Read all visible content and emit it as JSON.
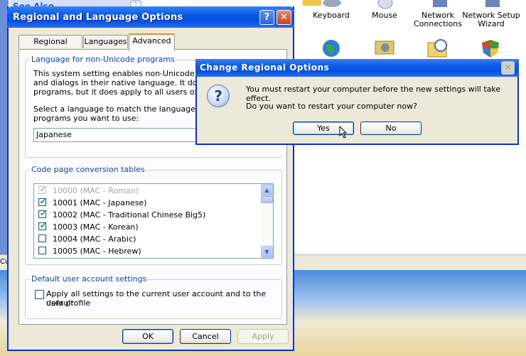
{
  "background": {
    "see_also": "See Also",
    "strip_cut": "Cus",
    "control_panel_items": [
      {
        "label": "Keyboard",
        "icon": "keyboard-icon"
      },
      {
        "label": "Mouse",
        "icon": "mouse-icon"
      },
      {
        "label": "Network Connections",
        "icon": "network-connections-icon"
      },
      {
        "label": "Network Setup Wizard",
        "icon": "network-wizard-icon"
      }
    ]
  },
  "dialog": {
    "title": "Regional and Language Options",
    "help": "?",
    "close": "✕",
    "tabs": [
      "Regional Options",
      "Languages",
      "Advanced"
    ],
    "active_tab": "Advanced",
    "non_unicode": {
      "legend": "Language for non-Unicode programs",
      "desc_lines": [
        "This system setting enables non-Unicode program",
        "and dialogs in their native language. It does not a",
        "programs, but it does apply to all users of this cor"
      ],
      "select_lines": [
        "Select a language to match the language version",
        "programs you want to use:"
      ],
      "selected_language": "Japanese"
    },
    "code_pages": {
      "legend": "Code page conversion tables",
      "items": [
        {
          "label": "10000 (MAC - Roman)",
          "checked": true,
          "disabled": true
        },
        {
          "label": "10001 (MAC - Japanese)",
          "checked": true,
          "disabled": false
        },
        {
          "label": "10002 (MAC - Traditional Chinese Big5)",
          "checked": true,
          "disabled": false
        },
        {
          "label": "10003 (MAC - Korean)",
          "checked": true,
          "disabled": false
        },
        {
          "label": "10004 (MAC - Arabic)",
          "checked": false,
          "disabled": false
        },
        {
          "label": "10005 (MAC - Hebrew)",
          "checked": false,
          "disabled": false
        }
      ]
    },
    "default_user": {
      "legend": "Default user account settings",
      "checkbox_line1": "Apply all settings to the current user account and to the default",
      "checkbox_line2": "user profile",
      "checked": false
    },
    "buttons": {
      "ok": "OK",
      "cancel": "Cancel",
      "apply": "Apply"
    }
  },
  "message_box": {
    "title": "Change Regional Options",
    "close": "✕",
    "icon": "question-icon",
    "line1": "You must restart your computer before the new settings will take effect.",
    "line2": "Do you want to restart your computer now?",
    "yes": "Yes",
    "no": "No"
  }
}
